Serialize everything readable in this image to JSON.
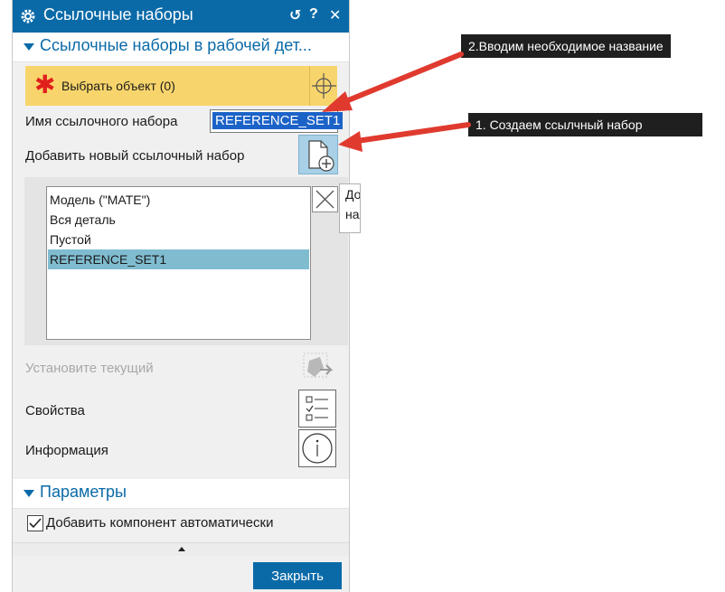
{
  "dialog": {
    "title": "Ссылочные наборы",
    "title_buttons": [
      "↺",
      "?",
      "✕"
    ],
    "section1": {
      "title": "Ссылочные наборы в рабочей дет...",
      "select_object": {
        "star": "✱",
        "label": "Выбрать объект (0)"
      },
      "name_label": "Имя ссылочного набора",
      "name_value": "REFERENCE_SET1",
      "add_new_label": "Добавить новый ссылочный набор",
      "list": {
        "items": [
          "Модель (\"MATE\")",
          "Вся деталь",
          "Пустой",
          "REFERENCE_SET1"
        ],
        "selected_index": 3
      },
      "tooltip_lines": [
        "До",
        "на("
      ],
      "set_current_label": "Установите текущий",
      "properties_label": "Свойства",
      "info_label": "Информация"
    },
    "section2": {
      "title": "Параметры",
      "auto_add_label": "Добавить компонент автоматически",
      "auto_add_checked": true
    },
    "close_label": "Закрыть"
  },
  "callouts": {
    "step2": "2.Вводим необходимое название",
    "step1": "1. Создаем ссылчный набор"
  },
  "colors": {
    "accent": "#0a6aa8",
    "select_row": "#f8d56c",
    "list_selected": "#80bcd0",
    "arrow": "#e03a2f"
  }
}
